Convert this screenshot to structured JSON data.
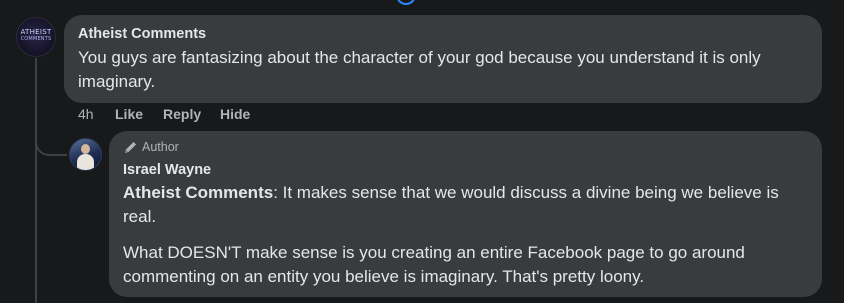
{
  "comment": {
    "author": "Atheist Comments",
    "avatar_text_line1": "ATHEIST",
    "avatar_text_line2": "COMMENTS",
    "text": "You guys are fantasizing about the character of your god because you understand it is only imaginary.",
    "time": "4h",
    "actions": {
      "like": "Like",
      "reply": "Reply",
      "hide": "Hide"
    }
  },
  "reply": {
    "badge": "Author",
    "badge_icon": "pencil-icon",
    "author": "Israel Wayne",
    "mention": "Atheist Comments",
    "text_after_mention": ": It makes sense that we would discuss a divine being we believe is real.",
    "paragraph2": "What DOESN'T make sense is you creating an entire Facebook page to go around commenting on an entity you believe is imaginary. That's pretty loony."
  },
  "colors": {
    "background": "#18191a",
    "bubble": "#3a3b3c",
    "text_primary": "#e4e6eb",
    "text_secondary": "#b0b3b8",
    "accent": "#2d88ff"
  }
}
